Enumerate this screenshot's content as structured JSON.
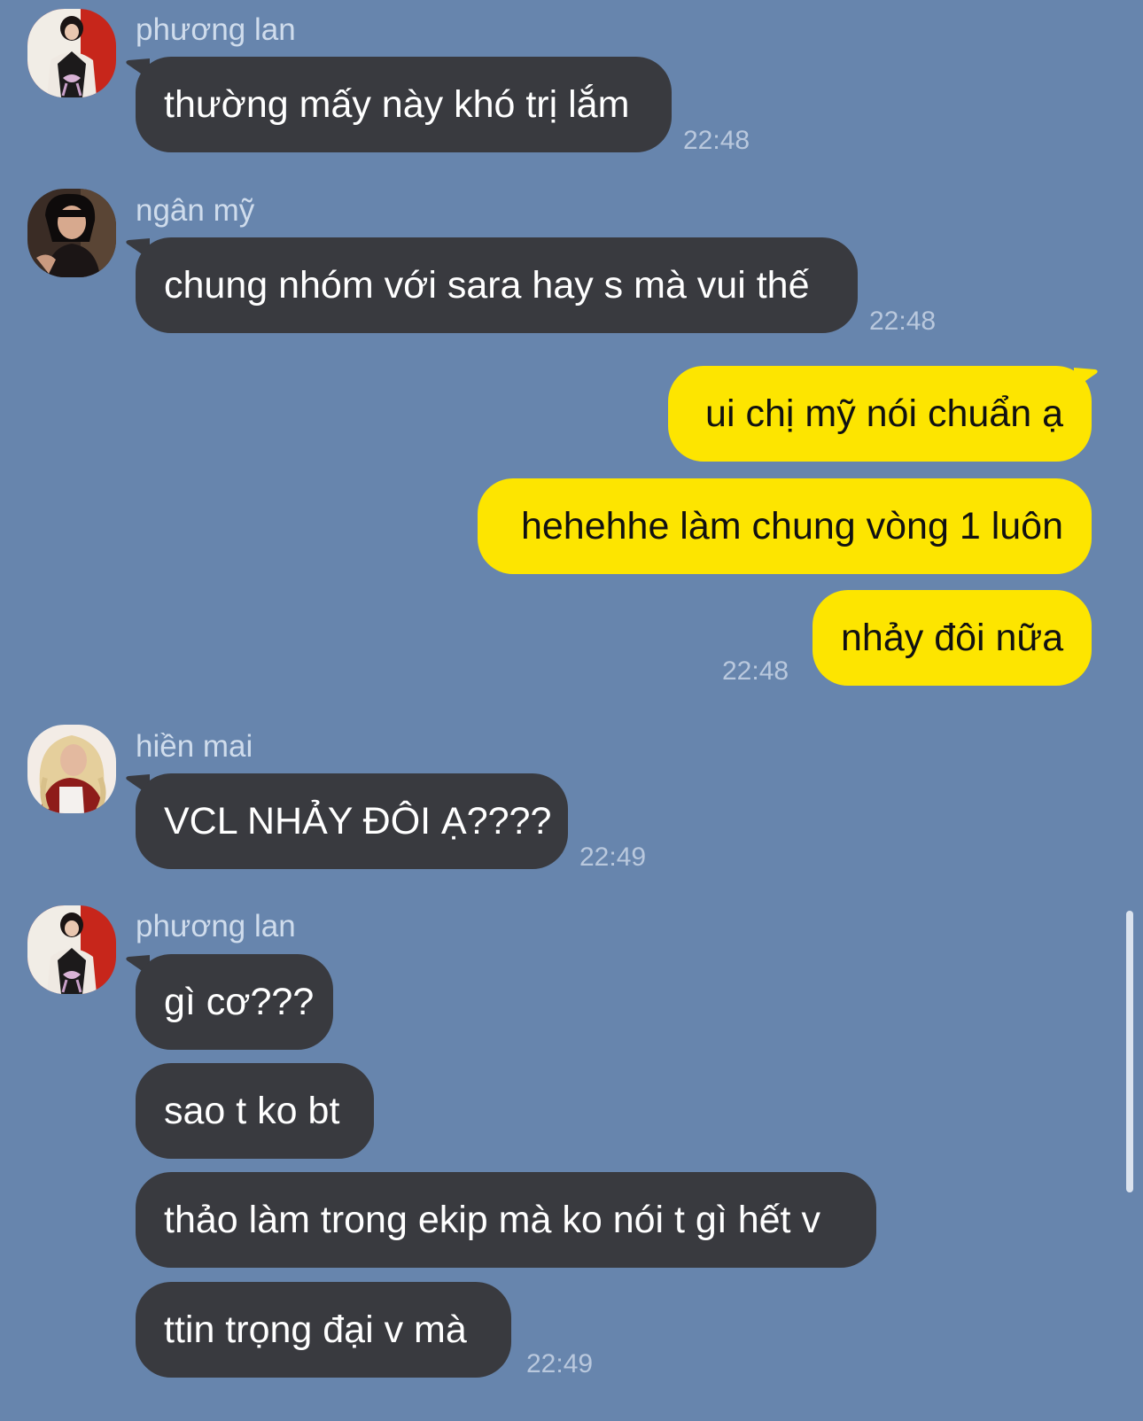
{
  "chat": {
    "colors": {
      "background": "#6785ad",
      "incoming_bubble": "#393a3f",
      "outgoing_bubble": "#fde500",
      "sender_name": "#cfdcec",
      "timestamp": "#b9c8dd"
    },
    "groups": [
      {
        "sender": "phương lan",
        "avatar": "avatar-phuong-lan",
        "messages": [
          "thường mấy này khó trị lắm"
        ],
        "time": "22:48"
      },
      {
        "sender": "ngân mỹ",
        "avatar": "avatar-ngan-my",
        "messages": [
          "chung nhóm với sara hay s mà vui thế"
        ],
        "time": "22:48"
      },
      {
        "sender": "",
        "outgoing": true,
        "messages": [
          "ui chị mỹ nói chuẩn ạ",
          "hehehhe làm chung vòng 1 luôn",
          "nhảy đôi nữa"
        ],
        "time": "22:48"
      },
      {
        "sender": "hiền mai",
        "avatar": "avatar-hien-mai",
        "messages": [
          "VCL NHẢY ĐÔI Ạ????"
        ],
        "time": "22:49"
      },
      {
        "sender": "phương lan",
        "avatar": "avatar-phuong-lan",
        "messages": [
          "gì cơ???",
          "sao t ko bt",
          "thảo làm trong ekip mà ko nói t gì hết v",
          "ttin trọng đại v mà"
        ],
        "time": "22:49"
      }
    ]
  }
}
